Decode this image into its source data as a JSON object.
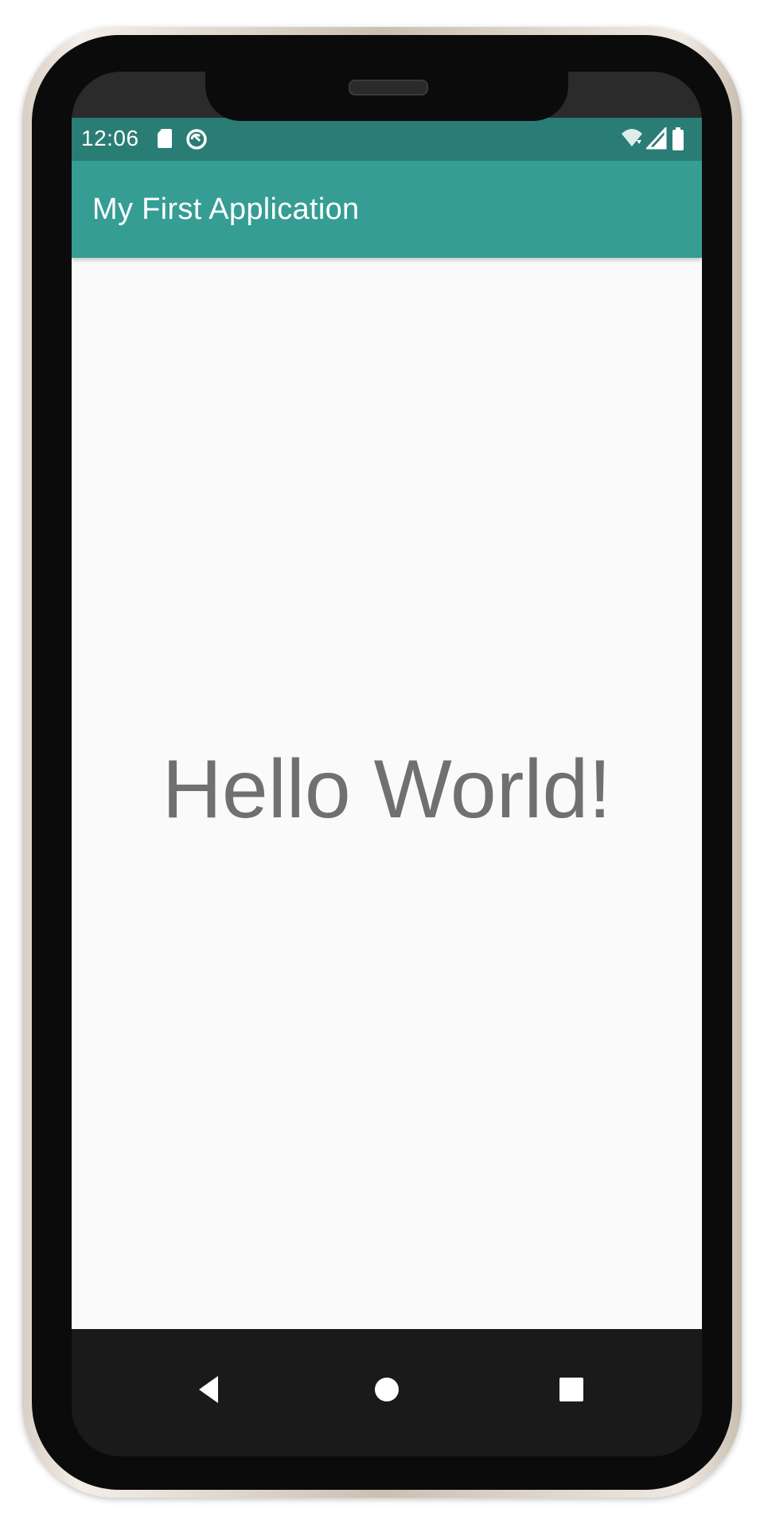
{
  "status_bar": {
    "time": "12:06",
    "icons": [
      "sd-card-icon",
      "sync-disabled-icon",
      "wifi-icon",
      "signal-icon",
      "battery-icon"
    ]
  },
  "app_bar": {
    "title": "My First Application",
    "color": "#359d94",
    "status_color": "#2a7d75"
  },
  "content": {
    "text": "Hello World!"
  },
  "nav_bar": {
    "buttons": [
      "back-icon",
      "home-icon",
      "recents-icon"
    ]
  }
}
